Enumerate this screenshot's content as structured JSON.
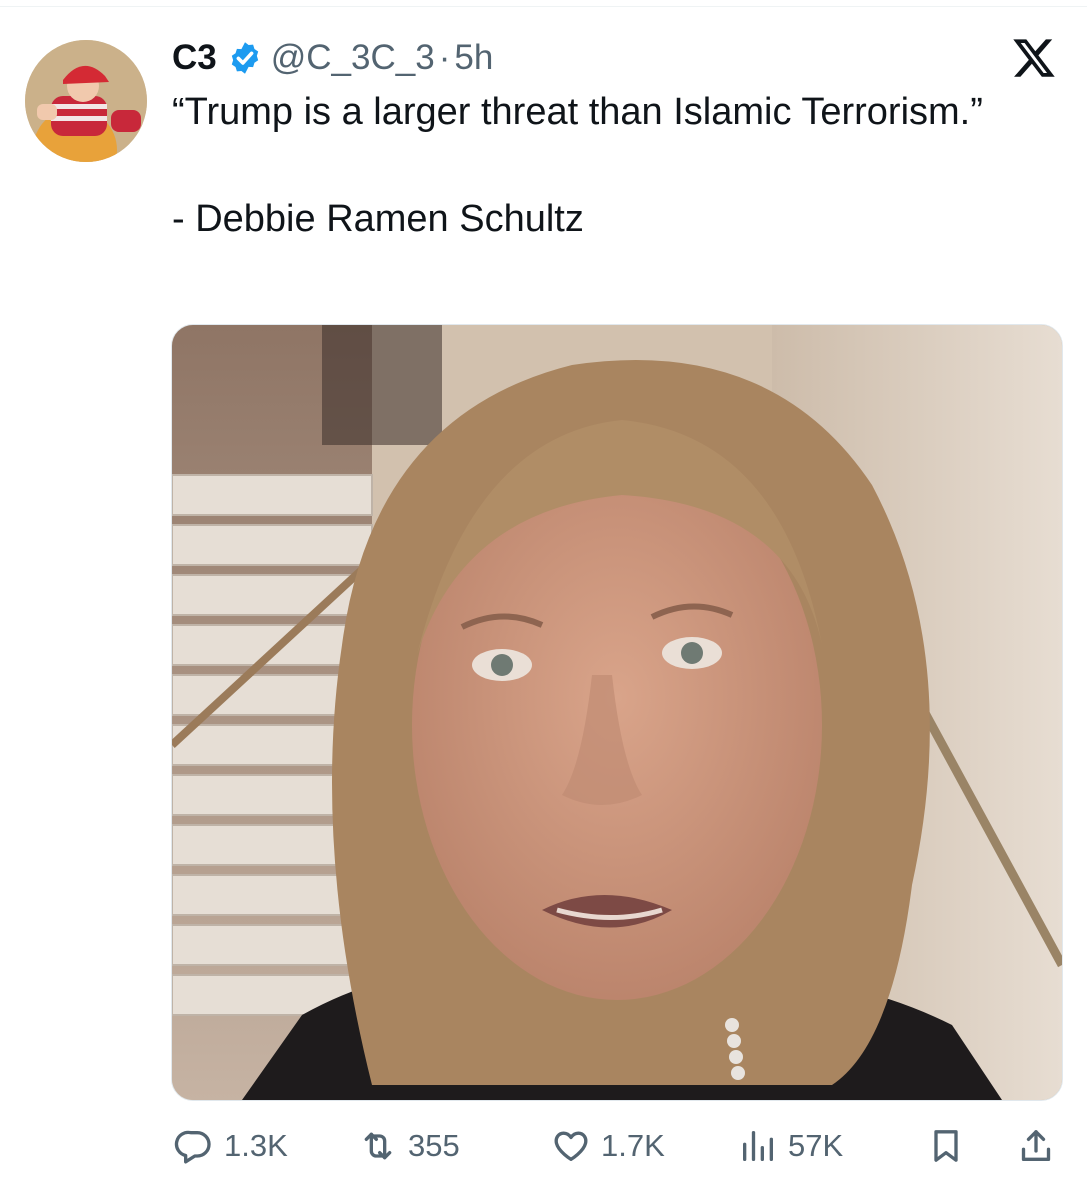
{
  "tweet": {
    "display_name": "C3",
    "handle": "@C_3C_3",
    "separator": "·",
    "time": "5h",
    "text_lines": [
      "“Trump is a larger threat than Islamic Terrorism.”",
      "- Debbie Ramen Schultz"
    ]
  },
  "actions": {
    "reply_count": "1.3K",
    "retweet_count": "355",
    "like_count": "1.7K",
    "views_count": "57K"
  },
  "icons": {
    "verified": "verified-badge-icon",
    "brand": "x-logo-icon",
    "reply": "reply-icon",
    "retweet": "retweet-icon",
    "like": "heart-icon",
    "views": "views-icon",
    "bookmark": "bookmark-icon",
    "share": "share-icon"
  },
  "colors": {
    "text": "#0f1419",
    "secondary": "#536471",
    "verified": "#1d9bf0",
    "background": "#ffffff"
  }
}
